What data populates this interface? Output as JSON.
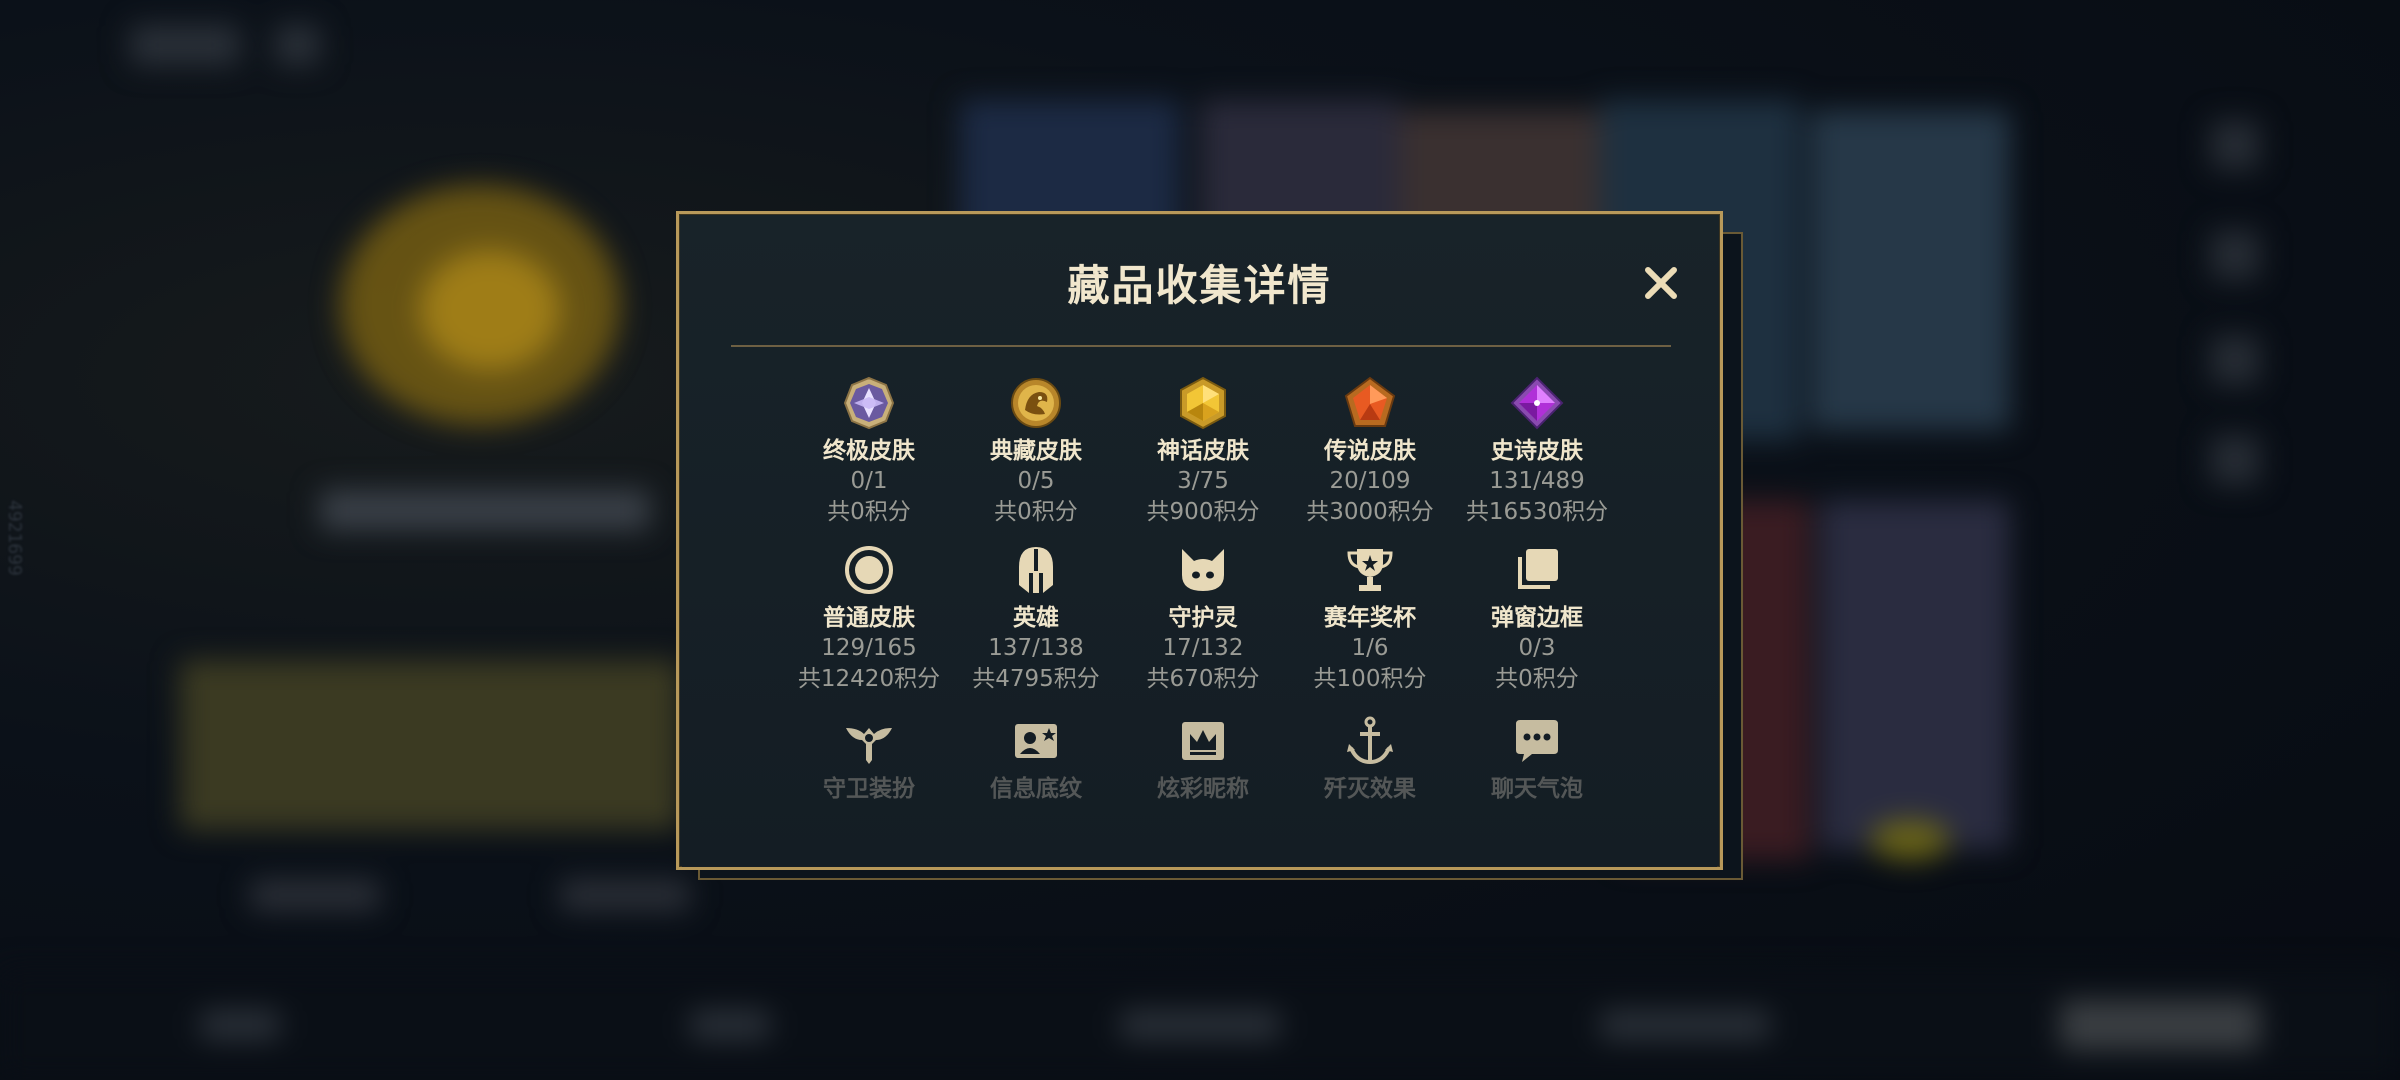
{
  "background": {
    "side_id": "4921699"
  },
  "modal": {
    "title": "藏品收集详情",
    "close_label": "✕",
    "rows": [
      [
        {
          "name": "终极皮肤",
          "count": "0/1",
          "points": "共0积分",
          "icon": "ultimate-skin-gem-icon"
        },
        {
          "name": "典藏皮肤",
          "count": "0/5",
          "points": "共0积分",
          "icon": "prestige-dragon-icon"
        },
        {
          "name": "神话皮肤",
          "count": "3/75",
          "points": "共900积分",
          "icon": "mythic-gem-icon"
        },
        {
          "name": "传说皮肤",
          "count": "20/109",
          "points": "共3000积分",
          "icon": "legendary-gem-icon"
        },
        {
          "name": "史诗皮肤",
          "count": "131/489",
          "points": "共16530积分",
          "icon": "epic-gem-icon"
        }
      ],
      [
        {
          "name": "普通皮肤",
          "count": "129/165",
          "points": "共12420积分",
          "icon": "standard-skin-ring-icon"
        },
        {
          "name": "英雄",
          "count": "137/138",
          "points": "共4795积分",
          "icon": "champion-helmet-icon"
        },
        {
          "name": "守护灵",
          "count": "17/132",
          "points": "共670积分",
          "icon": "guardian-pet-icon"
        },
        {
          "name": "赛年奖杯",
          "count": "1/6",
          "points": "共100积分",
          "icon": "trophy-icon"
        },
        {
          "name": "弹窗边框",
          "count": "0/3",
          "points": "共0积分",
          "icon": "popup-frame-icon"
        }
      ],
      [
        {
          "name": "守卫装扮",
          "icon": "ward-skin-icon"
        },
        {
          "name": "信息底纹",
          "icon": "profile-banner-icon"
        },
        {
          "name": "炫彩昵称",
          "icon": "nickname-crown-icon"
        },
        {
          "name": "歼灭效果",
          "icon": "finisher-anchor-icon"
        },
        {
          "name": "聊天气泡",
          "icon": "chat-bubble-icon"
        }
      ]
    ]
  },
  "colors": {
    "gold": "#b8995a",
    "title": "#f1e7cd",
    "muted": "#9a9b95",
    "panel": "#141d24"
  }
}
